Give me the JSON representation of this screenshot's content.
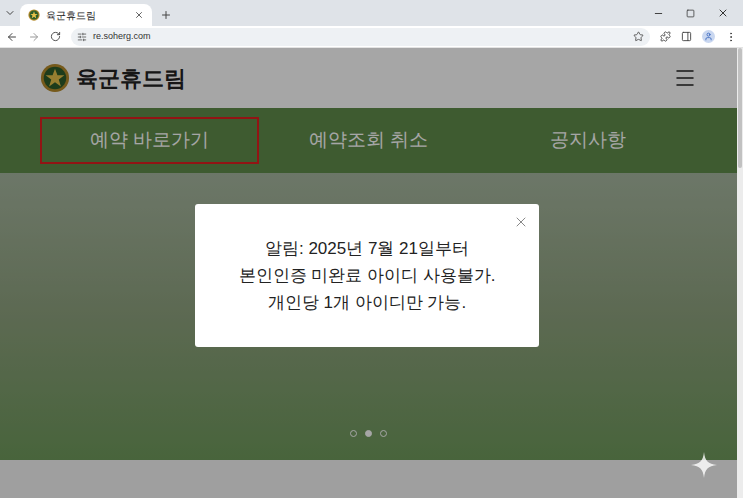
{
  "browser": {
    "tab": {
      "title": "육군휴드림",
      "selected": true
    },
    "address": "re.soherg.com"
  },
  "site": {
    "logo": "육군휴드림",
    "nav": [
      {
        "label": "예약 바로가기",
        "highlighted": true
      },
      {
        "label": "예약조회 취소",
        "highlighted": false
      },
      {
        "label": "공지사항",
        "highlighted": false
      }
    ]
  },
  "carousel": {
    "dots": [
      {
        "selected": false
      },
      {
        "selected": true
      },
      {
        "selected": false
      }
    ]
  },
  "modal": {
    "lines": [
      "알림: 2025년 7월 21일부터",
      "본인인증 미완료 아이디 사용불가.",
      "개인당 1개 아이디만 가능."
    ]
  }
}
